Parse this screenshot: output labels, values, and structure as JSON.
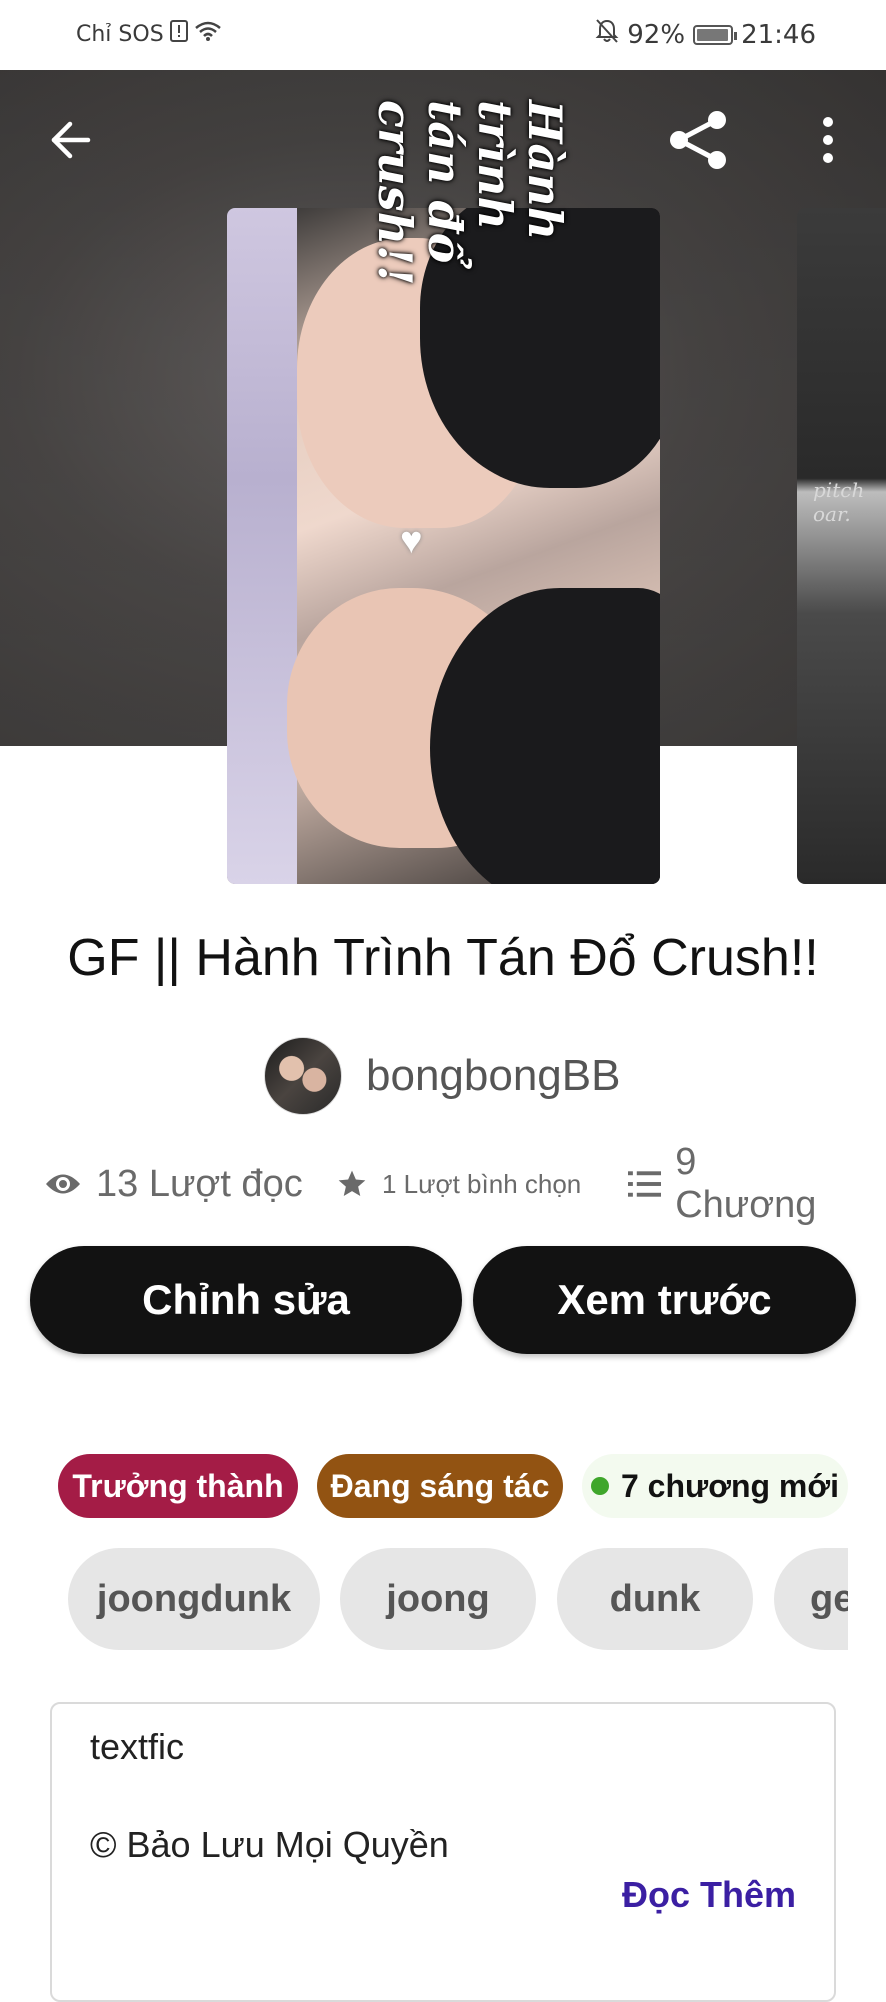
{
  "status_bar": {
    "carrier": "Chỉ SOS",
    "battery_percent": "92%",
    "time": "21:46"
  },
  "hero": {
    "cover_title_text": "Hành\ntrình\ntán đổ\ncrush!!",
    "next_cover_text": "pitch\noar."
  },
  "story": {
    "title": "GF || Hành Trình Tán Đổ Crush!!",
    "author": "bongbongBB"
  },
  "stats": {
    "reads": "13 Lượt đọc",
    "votes": "1 Lượt bình chọn",
    "parts": "9 Chương"
  },
  "actions": {
    "edit_label": "Chỉnh sửa",
    "preview_label": "Xem trước"
  },
  "badges": {
    "mature": "Trưởng thành",
    "ongoing": "Đang sáng tác",
    "new_parts": "7 chương mới"
  },
  "tags": [
    "joongdunk",
    "joong",
    "dunk",
    "ge"
  ],
  "description": {
    "line1": "textfic",
    "line2": "© Bảo Lưu Mọi Quyền",
    "read_more": "Đọc Thêm"
  },
  "colors": {
    "mature_badge": "#a41c46",
    "ongoing_badge": "#925312",
    "new_dot": "#3fa62b",
    "read_more": "#3b1fa3",
    "primary_button": "#121212"
  },
  "icons": [
    "back-arrow-icon",
    "share-icon",
    "more-vertical-icon",
    "eye-icon",
    "star-icon",
    "list-icon",
    "wifi-icon",
    "battery-icon",
    "mute-bell-icon"
  ]
}
